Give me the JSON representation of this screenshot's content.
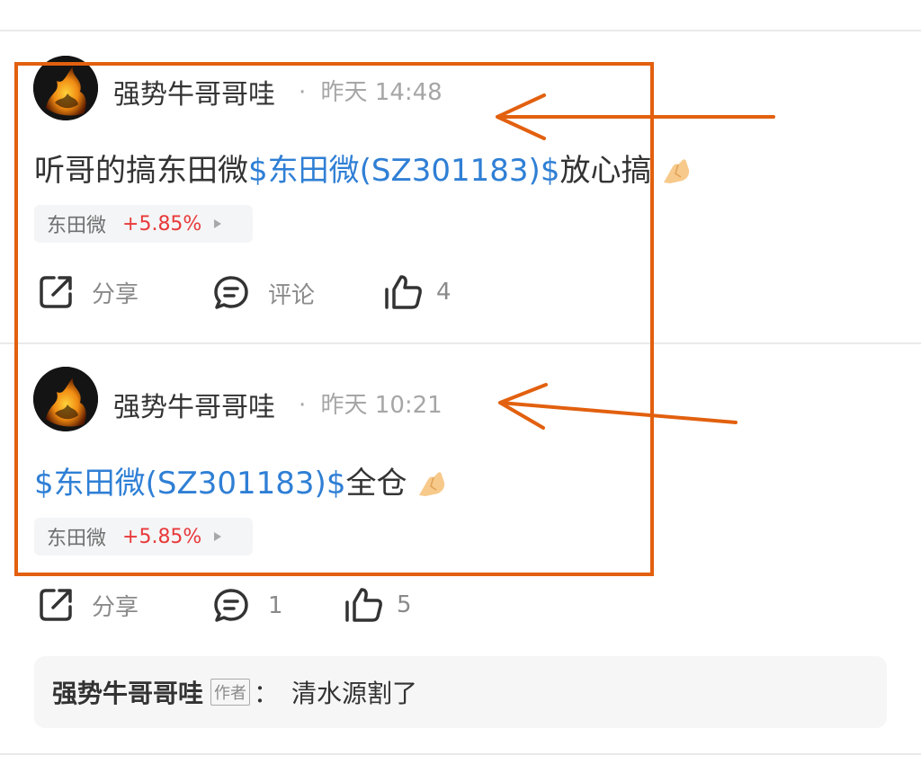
{
  "post1": {
    "username": "强势牛哥哥哇",
    "dot": "·",
    "time": "昨天 14:48",
    "text_prefix": "听哥的搞东田微",
    "cashtag": "$东田微(SZ301183)$",
    "text_suffix": "放心搞",
    "emoji": "folded-hands-emoji",
    "stock_chip": {
      "name": "东田微",
      "change": "+5.85%"
    },
    "actions": {
      "share": "分享",
      "comment": "评论",
      "like_count": "4"
    }
  },
  "post2": {
    "username": "强势牛哥哥哇",
    "dot": "·",
    "time": "昨天 10:21",
    "cashtag": "$东田微(SZ301183)$",
    "text_suffix": "全仓",
    "emoji": "folded-hands-emoji",
    "stock_chip": {
      "name": "东田微",
      "change": "+5.85%"
    },
    "actions": {
      "share": "分享",
      "comment_count": "1",
      "like_count": "5"
    }
  },
  "comment_preview": {
    "author": "强势牛哥哥哇",
    "badge": "作者",
    "colon": "：",
    "text": "清水源割了"
  },
  "colors": {
    "cashtag": "#2f7fd5",
    "positive_change": "#e8393a",
    "annotation": "#e2600f"
  },
  "icons": [
    "share-icon",
    "comment-icon",
    "thumbs-up-icon",
    "triangle-right-icon"
  ]
}
